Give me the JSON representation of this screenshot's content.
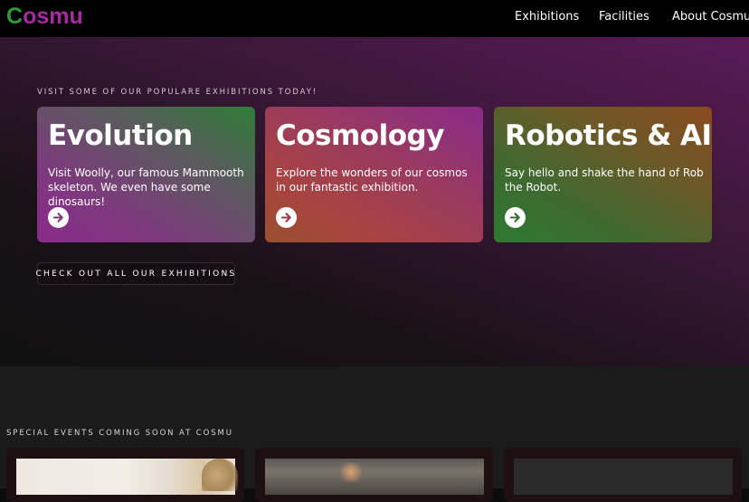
{
  "header": {
    "logo_first": "C",
    "logo_rest": "osmu",
    "nav": [
      "Exhibitions",
      "Facilities",
      "About Cosmu"
    ]
  },
  "hero": {
    "kicker": "VISIT SOME OF OUR POPULARE EXHIBITIONS TODAY!",
    "cards": [
      {
        "title": "Evolution",
        "text": "Visit Woolly, our famous Mammooth skeleton. We even have some dinosaurs!",
        "arrow_color": "#7a3a7a"
      },
      {
        "title": "Cosmology",
        "text": "Explore the wonders of our cosmos in our fantastic exhibition.",
        "arrow_color": "#9a3a50"
      },
      {
        "title": "Robotics & AI",
        "text": "Say hello and shake the hand of Rob the Robot.",
        "arrow_color": "#3a6a30"
      }
    ],
    "cta": "CHECK OUT ALL OUR EXHIBITIONS"
  },
  "events": {
    "kicker": "SPECIAL EVENTS COMING SOON AT COSMU"
  },
  "colors": {
    "logo_green": "#2e9a3c",
    "logo_purple": "#a82aa0",
    "header_bg": "#000000",
    "events_bg": "#1b1b1b"
  }
}
